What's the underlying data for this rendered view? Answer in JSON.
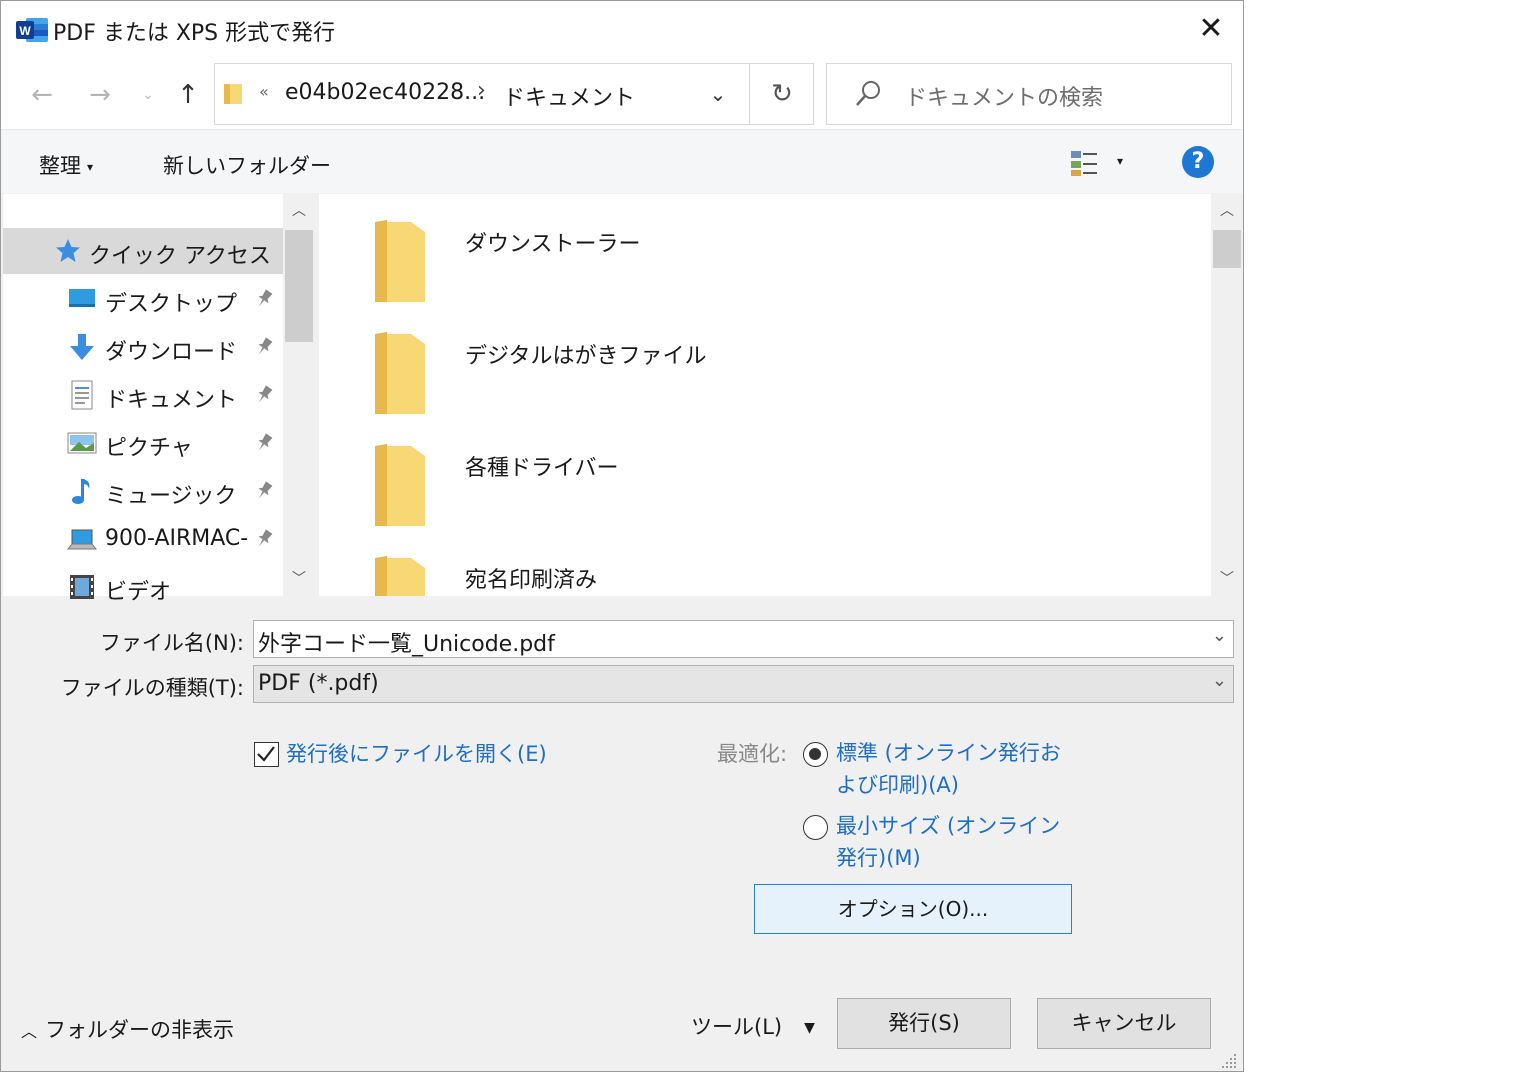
{
  "window": {
    "title": "PDF または XPS 形式で発行",
    "close": "✕"
  },
  "address": {
    "chevron": "«",
    "segment1": "e04b02ec40228...",
    "separator": "›",
    "segment2": "ドキュメント"
  },
  "search": {
    "placeholder": "ドキュメントの検索"
  },
  "toolbar": {
    "organize": "整理",
    "new_folder": "新しいフォルダー",
    "help": "?"
  },
  "navpane": {
    "quick_access": "クイック アクセス",
    "items": [
      {
        "label": "デスクトップ",
        "icon": "desktop-icon"
      },
      {
        "label": "ダウンロード",
        "icon": "download-icon"
      },
      {
        "label": "ドキュメント",
        "icon": "documents-icon"
      },
      {
        "label": "ピクチャ",
        "icon": "pictures-icon"
      },
      {
        "label": "ミュージック",
        "icon": "music-icon"
      },
      {
        "label": "900-AIRMAC-",
        "icon": "computer-icon"
      },
      {
        "label": "ビデオ",
        "icon": "video-icon"
      }
    ]
  },
  "files": [
    {
      "name": "ダウンストーラー"
    },
    {
      "name": "デジタルはがきファイル"
    },
    {
      "name": "各種ドライバー"
    },
    {
      "name": "宛名印刷済み"
    }
  ],
  "form": {
    "filename_label": "ファイル名(N):",
    "filename_value": "外字コード一覧_Unicode.pdf",
    "filetype_label": "ファイルの種類(T):",
    "filetype_value": "PDF (*.pdf)",
    "open_after_label": "発行後にファイルを開く(E)",
    "open_after_checked": true,
    "optimize_label": "最適化:",
    "radio_standard": "標準 (オンライン発行および印刷)(A)",
    "radio_minimum": "最小サイズ (オンライン発行)(M)",
    "selected_optimization": "standard",
    "options_button": "オプション(O)..."
  },
  "footer": {
    "hide_folders": "フォルダーの非表示",
    "tools": "ツール(L)",
    "publish": "発行(S)",
    "cancel": "キャンセル"
  },
  "colors": {
    "accent": "#1e6fc4",
    "help_blue": "#1e77d3",
    "folder_yellow": "#f8d775"
  }
}
